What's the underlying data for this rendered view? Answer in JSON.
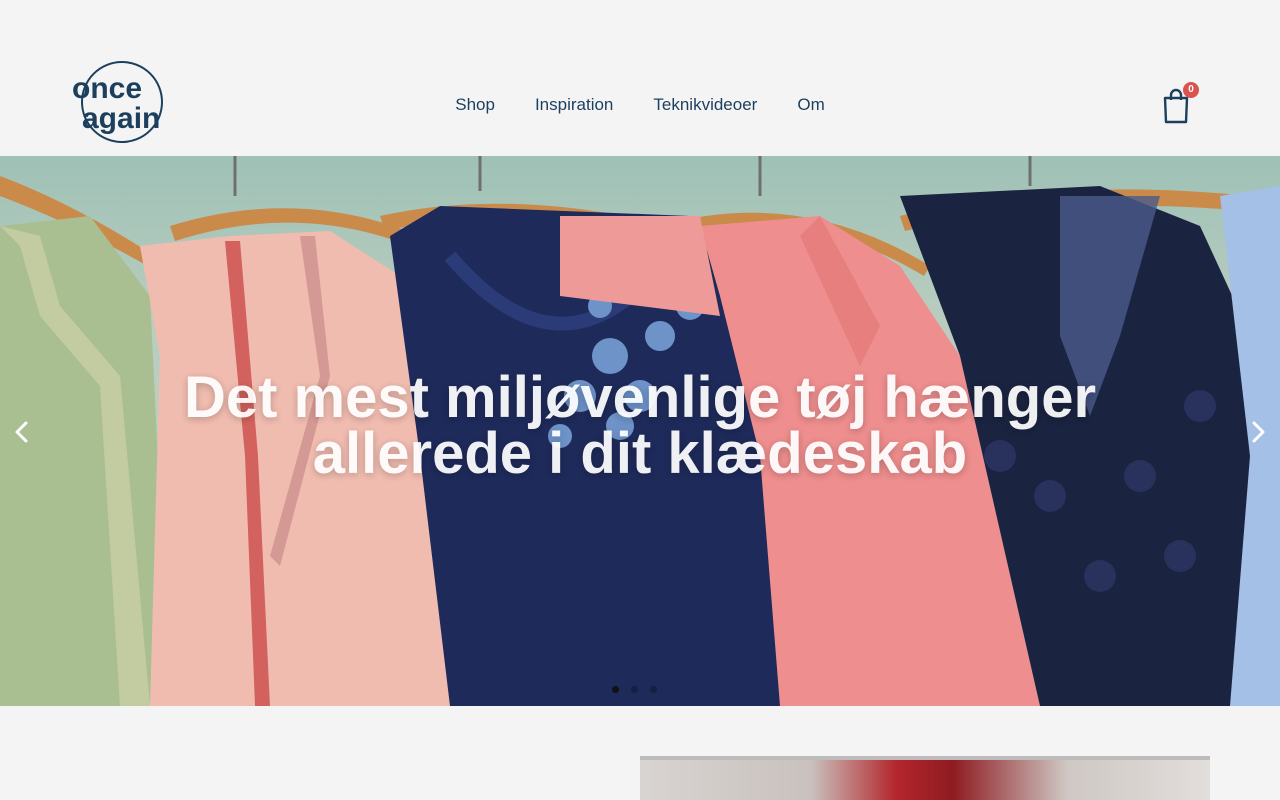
{
  "header": {
    "logo": {
      "line1": "once",
      "line2": "again"
    },
    "nav": [
      {
        "label": "Shop"
      },
      {
        "label": "Inspiration"
      },
      {
        "label": "Teknikvideoer"
      },
      {
        "label": "Om"
      }
    ],
    "cart": {
      "icon": "shopping-bag-icon",
      "count": "0"
    }
  },
  "hero": {
    "title": "Det mest miljøvenlige tøj hænger allerede i dit klædeskab",
    "prev_icon": "chevron-left-icon",
    "next_icon": "chevron-right-icon",
    "slides": 3,
    "active_slide": 1
  },
  "colors": {
    "brand": "#1c3f5e",
    "background": "#f4f4f4",
    "badge": "#d9534f"
  }
}
